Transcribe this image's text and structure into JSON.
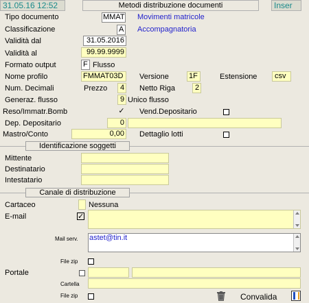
{
  "header": {
    "datetime": "31.05.16 12:52",
    "title": "Metodi distribuzione documenti",
    "mode": "Inser"
  },
  "fields": {
    "tipo_documento": {
      "label": "Tipo documento",
      "value": "MMAT",
      "desc": "Movimenti matricole"
    },
    "classificazione": {
      "label": "Classificazione",
      "value": "A",
      "desc": "Accompagnatoria"
    },
    "validita_dal": {
      "label": "Validità dal",
      "value": "31.05.2016"
    },
    "validita_al": {
      "label": "Validità  al",
      "value": "99.99.9999"
    },
    "formato_output": {
      "label": "Formato output",
      "value": "F",
      "desc": "Flusso"
    },
    "nome_profilo": {
      "label": "Nome profilo",
      "value": "FMMAT03D"
    },
    "versione": {
      "label": "Versione",
      "value": "1F"
    },
    "estensione": {
      "label": "Estensione",
      "value": "csv"
    },
    "num_decimali": {
      "label": "Num. Decimali"
    },
    "prezzo": {
      "label": "Prezzo",
      "value": "4"
    },
    "netto_riga": {
      "label": "Netto Riga",
      "value": "2"
    },
    "generaz_flusso": {
      "label": "Generaz. flusso",
      "value": "9",
      "desc": "Unico flusso"
    },
    "reso": {
      "label": "Reso/Immatr.Bomb",
      "checked": true
    },
    "vend_depositario": {
      "label": "Vend.Depositario",
      "checked": false
    },
    "dep_depositario": {
      "label": "Dep. Depositario",
      "value": "0",
      "desc": ""
    },
    "mastro_conto": {
      "label": "Mastro/Conto",
      "value": "0,00"
    },
    "dettaglio_lotti": {
      "label": "Dettaglio lotti",
      "checked": false
    }
  },
  "soggetti": {
    "title": "Identificazione soggetti",
    "mittente": {
      "label": "Mittente",
      "value": ""
    },
    "destinatario": {
      "label": "Destinatario",
      "value": ""
    },
    "intestatario": {
      "label": "Intestatario",
      "value": ""
    }
  },
  "canale": {
    "title": "Canale di distribuzione",
    "cartaceo": {
      "label": "Cartaceo",
      "value": "",
      "desc": "Nessuna"
    },
    "email": {
      "label": "E-mail",
      "checked": true,
      "text": ""
    },
    "mail_serv": {
      "label": "Mail serv.",
      "value": "astet@tin.it"
    },
    "file_zip_1": {
      "label": "File zip",
      "checked": false
    },
    "portale": {
      "label": "Portale",
      "checked": false,
      "code": "",
      "desc": ""
    },
    "cartella": {
      "label": "Cartella",
      "value": ""
    },
    "file_zip_2": {
      "label": "File zip",
      "checked": false
    }
  },
  "footer": {
    "trash_icon": "trash-icon",
    "convalida": {
      "label": "Convalida",
      "checked": false
    }
  }
}
